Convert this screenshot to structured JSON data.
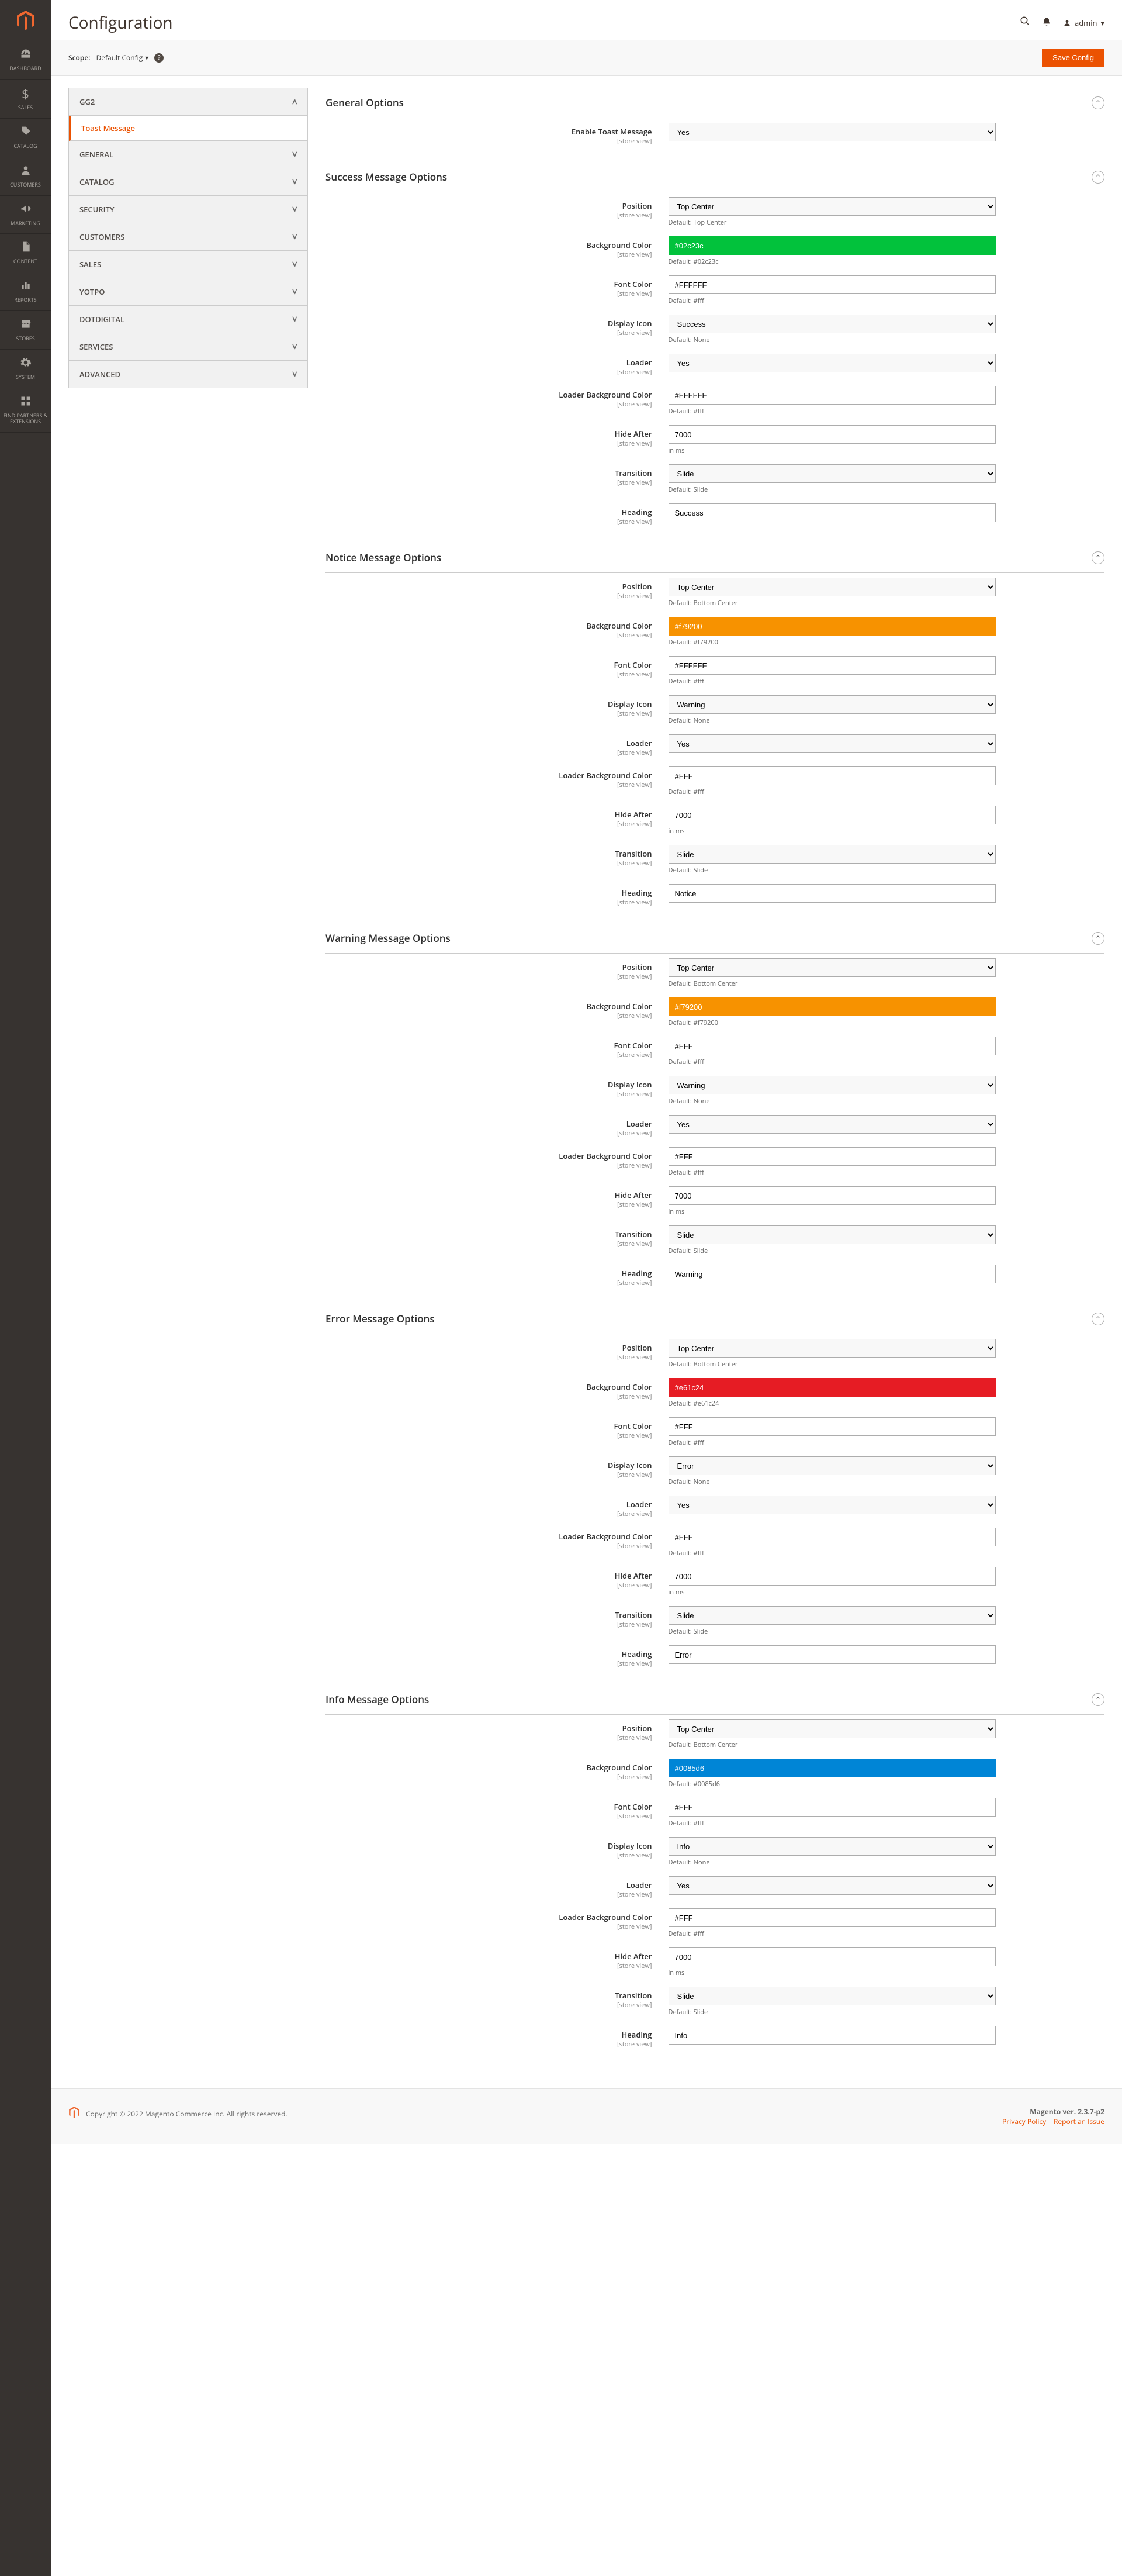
{
  "page_title": "Configuration",
  "admin_user": "admin",
  "scope_label": "Scope:",
  "scope_value": "Default Config",
  "save_button": "Save Config",
  "sidebar": [
    {
      "icon": "dashboard",
      "label": "DASHBOARD"
    },
    {
      "icon": "dollar",
      "label": "SALES"
    },
    {
      "icon": "tag",
      "label": "CATALOG"
    },
    {
      "icon": "person",
      "label": "CUSTOMERS"
    },
    {
      "icon": "megaphone",
      "label": "MARKETING"
    },
    {
      "icon": "page",
      "label": "CONTENT"
    },
    {
      "icon": "chart",
      "label": "REPORTS"
    },
    {
      "icon": "stores",
      "label": "STORES"
    },
    {
      "icon": "gear",
      "label": "SYSTEM"
    },
    {
      "icon": "partners",
      "label": "FIND PARTNERS & EXTENSIONS"
    }
  ],
  "tabs": [
    {
      "label": "GG2",
      "expanded": true,
      "children": [
        {
          "label": "Toast Message",
          "active": true
        }
      ]
    },
    {
      "label": "GENERAL"
    },
    {
      "label": "CATALOG"
    },
    {
      "label": "SECURITY"
    },
    {
      "label": "CUSTOMERS"
    },
    {
      "label": "SALES"
    },
    {
      "label": "YOTPO"
    },
    {
      "label": "DOTDIGITAL"
    },
    {
      "label": "SERVICES"
    },
    {
      "label": "ADVANCED"
    }
  ],
  "fs_general": {
    "title": "General Options",
    "enable_label": "Enable Toast Message",
    "enable_value": "Yes"
  },
  "fs_success": {
    "title": "Success Message Options",
    "position_label": "Position",
    "position_value": "Top Center",
    "position_note": "Default: Top Center",
    "bg_label": "Background Color",
    "bg_value": "#02c23c",
    "bg_note": "Default: #02c23c",
    "font_label": "Font Color",
    "font_value": "#FFFFFF",
    "font_note": "Default: #fff",
    "icon_label": "Display Icon",
    "icon_value": "Success",
    "icon_note": "Default: None",
    "loader_label": "Loader",
    "loader_value": "Yes",
    "loaderbg_label": "Loader Background Color",
    "loaderbg_value": "#FFFFFF",
    "loaderbg_note": "Default: #fff",
    "hide_label": "Hide After",
    "hide_value": "7000",
    "hide_note": "in ms",
    "trans_label": "Transition",
    "trans_value": "Slide",
    "trans_note": "Default: Slide",
    "heading_label": "Heading",
    "heading_value": "Success"
  },
  "fs_notice": {
    "title": "Notice Message Options",
    "position_value": "Top Center",
    "position_note": "Default: Bottom Center",
    "bg_value": "#f79200",
    "bg_note": "Default: #f79200",
    "font_value": "#FFFFFF",
    "font_note": "Default: #fff",
    "icon_value": "Warning",
    "icon_note": "Default: None",
    "loader_value": "Yes",
    "loaderbg_value": "#FFF",
    "loaderbg_note": "Default: #fff",
    "hide_value": "7000",
    "hide_note": "in ms",
    "trans_value": "Slide",
    "trans_note": "Default: Slide",
    "heading_value": "Notice"
  },
  "fs_warning": {
    "title": "Warning Message Options",
    "position_value": "Top Center",
    "position_note": "Default: Bottom Center",
    "bg_value": "#f79200",
    "bg_note": "Default: #f79200",
    "font_value": "#FFF",
    "font_note": "Default: #fff",
    "icon_value": "Warning",
    "icon_note": "Default: None",
    "loader_value": "Yes",
    "loaderbg_value": "#FFF",
    "loaderbg_note": "Default: #fff",
    "hide_value": "7000",
    "hide_note": "in ms",
    "trans_value": "Slide",
    "trans_note": "Default: Slide",
    "heading_value": "Warning"
  },
  "fs_error": {
    "title": "Error Message Options",
    "position_value": "Top Center",
    "position_note": "Default: Bottom Center",
    "bg_value": "#e61c24",
    "bg_note": "Default: #e61c24",
    "font_value": "#FFF",
    "font_note": "Default: #fff",
    "icon_value": "Error",
    "icon_note": "Default: None",
    "loader_value": "Yes",
    "loaderbg_value": "#FFF",
    "loaderbg_note": "Default: #fff",
    "hide_value": "7000",
    "hide_note": "in ms",
    "trans_value": "Slide",
    "trans_note": "Default: Slide",
    "heading_value": "Error"
  },
  "fs_info": {
    "title": "Info Message Options",
    "position_value": "Top Center",
    "position_note": "Default: Bottom Center",
    "bg_value": "#0085d6",
    "bg_note": "Default: #0085d6",
    "font_value": "#FFF",
    "font_note": "Default: #fff",
    "icon_value": "Info",
    "icon_note": "Default: None",
    "loader_value": "Yes",
    "loaderbg_value": "#FFF",
    "loaderbg_note": "Default: #fff",
    "hide_value": "7000",
    "hide_note": "in ms",
    "trans_value": "Slide",
    "trans_note": "Default: Slide",
    "heading_value": "Info"
  },
  "store_view_text": "[store view]",
  "footer": {
    "copyright": "Copyright © 2022 Magento Commerce Inc. All rights reserved.",
    "version": "Magento ver. 2.3.7-p2",
    "privacy": "Privacy Policy",
    "sep": " | ",
    "report": "Report an Issue"
  }
}
